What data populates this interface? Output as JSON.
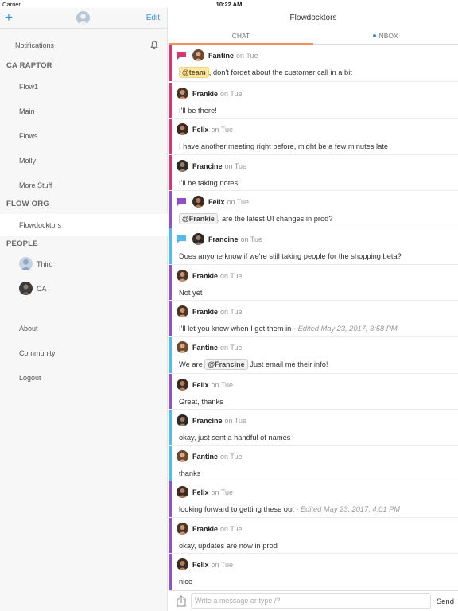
{
  "status_bar": {
    "carrier": "Carrier",
    "time": "10:22 AM"
  },
  "sidebar": {
    "add_label": "+",
    "edit_label": "Edit",
    "notifications": "Notifications",
    "sections": [
      {
        "title": "CA RAPTOR",
        "items": [
          "Flow1",
          "Main",
          "Flows",
          "Molly",
          "More Stuff"
        ]
      },
      {
        "title": "FLOW ORG",
        "items": [
          "Flowdocktors"
        ]
      },
      {
        "title": "PEOPLE",
        "people": [
          "Third",
          "CA"
        ]
      }
    ],
    "footer": [
      "About",
      "Community",
      "Logout"
    ]
  },
  "main": {
    "title": "Flowdocktors",
    "tabs": {
      "chat": "CHAT",
      "inbox": "INBOX"
    },
    "messages": [
      {
        "author": "Fantine",
        "when": "on Tue",
        "mention": "@team",
        "text": ", don't forget about the customer call in a bit",
        "color": "#d23a6d",
        "icon": "chat-bubble-pink"
      },
      {
        "author": "Frankie",
        "when": "on Tue",
        "text": "I'll be there!",
        "color": "#d23a6d"
      },
      {
        "author": "Felix",
        "when": "on Tue",
        "text": "I have another meeting right before, might be a few minutes late",
        "color": "#d23a6d"
      },
      {
        "author": "Francine",
        "when": "on Tue",
        "text": "I'll be taking notes",
        "color": "#d23a6d"
      },
      {
        "author": "Felix",
        "when": "on Tue",
        "mention": "@Frankie",
        "text": ", are the latest UI changes in prod?",
        "color": "#8e52c7",
        "icon": "chat-bubble-purple"
      },
      {
        "author": "Francine",
        "when": "on Tue",
        "text": "Does anyone know if we're still taking people for the shopping beta?",
        "color": "#5ab8e8",
        "icon": "chat-bubble-blue"
      },
      {
        "author": "Frankie",
        "when": "on Tue",
        "text": "Not yet",
        "color": "#8e52c7"
      },
      {
        "author": "Frankie",
        "when": "on Tue",
        "text": "I'll let you know when I get them in",
        "edited": " - Edited May 23, 2017, 3:58 PM",
        "color": "#8e52c7"
      },
      {
        "author": "Fantine",
        "when": "on Tue",
        "pre": "We are ",
        "mention": "@Francine",
        "text": " Just email me their info!",
        "color": "#5ab8e8"
      },
      {
        "author": "Felix",
        "when": "on Tue",
        "text": "Great, thanks",
        "color": "#8e52c7"
      },
      {
        "author": "Francine",
        "when": "on Tue",
        "text": "okay, just sent a handful of names",
        "color": "#5ab8e8"
      },
      {
        "author": "Fantine",
        "when": "on Tue",
        "text": "thanks",
        "color": "#5ab8e8"
      },
      {
        "author": "Felix",
        "when": "on Tue",
        "text": "looking forward to getting these out",
        "edited": " - Edited May 23, 2017, 4:01 PM",
        "color": "#8e52c7"
      },
      {
        "author": "Frankie",
        "when": "on Tue",
        "text": "okay, updates are now in prod",
        "color": "#8e52c7"
      },
      {
        "author": "Felix",
        "when": "on Tue",
        "text": "nice",
        "color": "#8e52c7"
      }
    ]
  },
  "composer": {
    "placeholder": "Write a message or type /?",
    "send_label": "Send"
  }
}
